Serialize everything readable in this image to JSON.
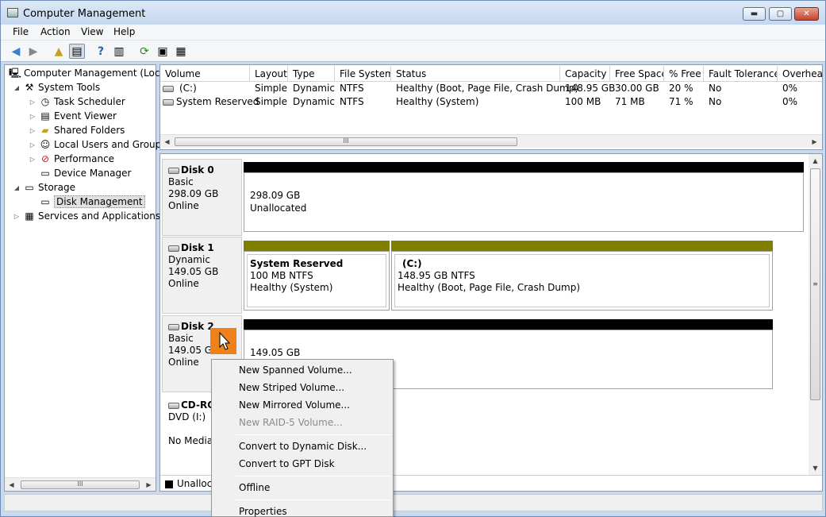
{
  "window": {
    "title": "Computer Management",
    "min": "▬",
    "max": "▢",
    "close": "✕"
  },
  "menu": [
    "File",
    "Action",
    "View",
    "Help"
  ],
  "tree": {
    "root": "Computer Management (Local",
    "system_tools": "System Tools",
    "task_scheduler": "Task Scheduler",
    "event_viewer": "Event Viewer",
    "shared_folders": "Shared Folders",
    "local_users": "Local Users and Groups",
    "performance": "Performance",
    "device_manager": "Device Manager",
    "storage": "Storage",
    "disk_management": "Disk Management",
    "services": "Services and Applications"
  },
  "volumes": {
    "columns": [
      "Volume",
      "Layout",
      "Type",
      "File System",
      "Status",
      "Capacity",
      "Free Space",
      "% Free",
      "Fault Tolerance",
      "Overhead"
    ],
    "rows": [
      [
        "(C:)",
        "Simple",
        "Dynamic",
        "NTFS",
        "Healthy (Boot, Page File, Crash Dump)",
        "148.95 GB",
        "30.00 GB",
        "20 %",
        "No",
        "0%"
      ],
      [
        "System Reserved",
        "Simple",
        "Dynamic",
        "NTFS",
        "Healthy (System)",
        "100 MB",
        "71 MB",
        "71 %",
        "No",
        "0%"
      ]
    ]
  },
  "disks": {
    "disk0": {
      "name": "Disk 0",
      "type": "Basic",
      "size": "298.09 GB",
      "state": "Online",
      "part_size": "298.09 GB",
      "part_status": "Unallocated"
    },
    "disk1": {
      "name": "Disk 1",
      "type": "Dynamic",
      "size": "149.05 GB",
      "state": "Online",
      "p1_name": "System Reserved",
      "p1_size": "100 MB NTFS",
      "p1_status": "Healthy (System)",
      "p2_name": "(C:)",
      "p2_size": "148.95 GB NTFS",
      "p2_status": "Healthy (Boot, Page File, Crash Dump)"
    },
    "disk2": {
      "name": "Disk 2",
      "type": "Basic",
      "size": "149.05 GB",
      "state": "Online",
      "part_size": "149.05 GB"
    },
    "cdrom": {
      "name": "CD-RO",
      "type": "DVD (I:)",
      "media": "No Media"
    }
  },
  "legend": {
    "unallocated": "Unalloca"
  },
  "scroll": {
    "thumb": "III"
  },
  "context_menu": {
    "new_spanned": "New Spanned Volume...",
    "new_striped": "New Striped Volume...",
    "new_mirrored": "New Mirrored Volume...",
    "new_raid5": "New RAID-5 Volume...",
    "convert_dynamic": "Convert to Dynamic Disk...",
    "convert_gpt": "Convert to GPT Disk",
    "offline": "Offline",
    "properties": "Properties"
  },
  "colors": {
    "primary_partition_bar": "#000000",
    "dynamic_simple_bar": "#808000",
    "unallocated": "#000000"
  }
}
